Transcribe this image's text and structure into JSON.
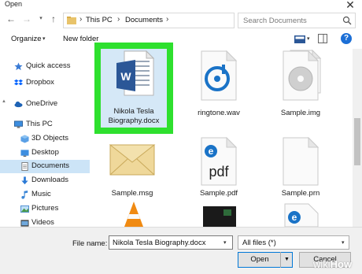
{
  "window": {
    "title": "Open"
  },
  "address": {
    "crumbs": [
      "This PC",
      "Documents"
    ],
    "search_placeholder": "Search Documents"
  },
  "toolbar": {
    "organize": "Organize",
    "new_folder": "New folder"
  },
  "nav": {
    "items": [
      {
        "label": "Quick access",
        "icon": "star-icon"
      },
      {
        "label": "Dropbox",
        "icon": "dropbox-icon"
      },
      {
        "label": "OneDrive",
        "icon": "cloud-icon"
      },
      {
        "label": "This PC",
        "icon": "computer-icon"
      },
      {
        "label": "3D Objects",
        "icon": "cube-icon"
      },
      {
        "label": "Desktop",
        "icon": "desktop-icon"
      },
      {
        "label": "Documents",
        "icon": "documents-icon",
        "selected": true
      },
      {
        "label": "Downloads",
        "icon": "download-icon"
      },
      {
        "label": "Music",
        "icon": "music-icon"
      },
      {
        "label": "Pictures",
        "icon": "pictures-icon"
      },
      {
        "label": "Videos",
        "icon": "videos-icon"
      }
    ]
  },
  "files": [
    {
      "name_line1": "Nikola Tesla",
      "name_line2": "Biography.docx",
      "icon": "word-document-icon",
      "selected": true
    },
    {
      "name_line1": "ringtone.wav",
      "icon": "audio-file-icon"
    },
    {
      "name_line1": "Sample.img",
      "icon": "disc-image-icon"
    },
    {
      "name_line1": "Sample.msg",
      "icon": "envelope-icon"
    },
    {
      "name_line1": "Sample.pdf",
      "icon": "pdf-file-icon"
    },
    {
      "name_line1": "Sample.prn",
      "icon": "generic-file-icon"
    },
    {
      "name_line1": "",
      "icon": "vlc-cone-icon"
    },
    {
      "name_line1": "",
      "icon": "video-thumbnail-icon"
    },
    {
      "name_line1": "",
      "icon": "edge-file-icon"
    }
  ],
  "bottom": {
    "file_name_label": "File name:",
    "file_name_value": "Nikola Tesla Biography.docx",
    "filter": "All files (*)",
    "open": "Open",
    "cancel": "Cancel"
  },
  "watermark": {
    "wiki": "wiki",
    "how": "How"
  },
  "colors": {
    "selection_highlight": "#2ee02e",
    "selection_fill": "#d5e8f7",
    "nav_selected": "#cce4f7",
    "word_blue": "#2b5797",
    "edge_blue": "#1a73c7"
  }
}
